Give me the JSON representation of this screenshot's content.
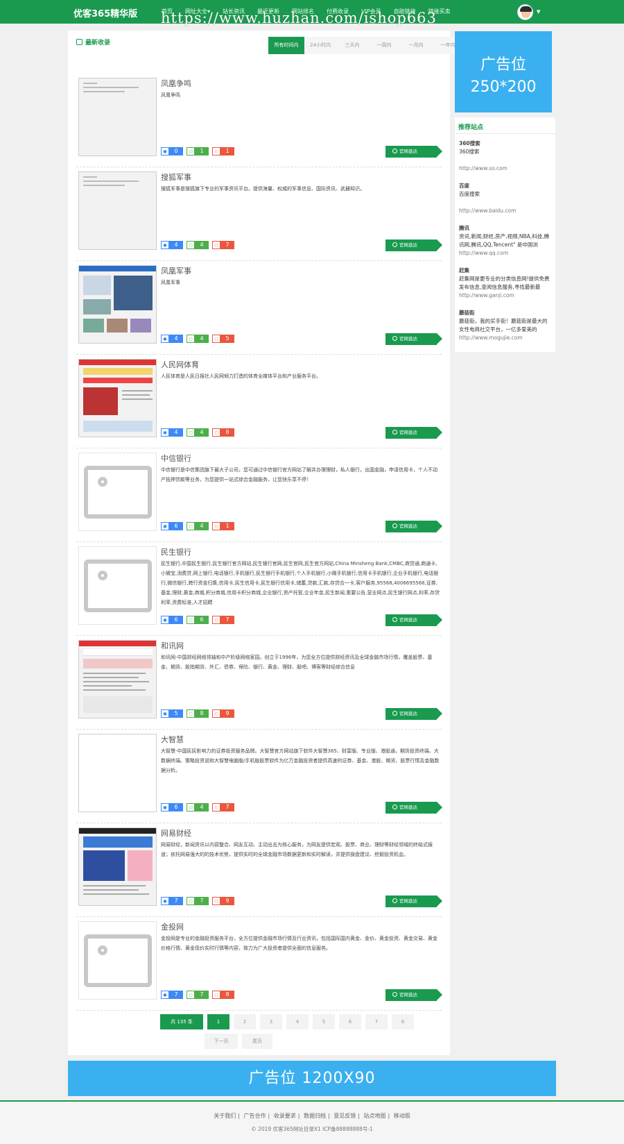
{
  "nav": {
    "logo": "优客365精华版",
    "menu": [
      "首页",
      "网址大全▾",
      "站长资讯",
      "最近更新",
      "网站排名",
      "付费收录",
      "VIP会员",
      "自助链接",
      "链接买卖"
    ],
    "watermark": "https://www.huzhan.com/ishop663"
  },
  "main": {
    "heading": "最新收录",
    "tabs": [
      "所有时间内",
      "24小时内",
      "三天内",
      "一周内",
      "一月内",
      "一年内"
    ]
  },
  "visit_label": "官网直达",
  "items": [
    {
      "title": "凤凰争鸣",
      "desc": "凤凰争鸣",
      "stats": [
        "0",
        "1",
        "1"
      ]
    },
    {
      "title": "搜狐军事",
      "desc": "搜狐军事是搜狐旗下专业的军事资讯平台。提供海量、权威的军事信息、国际资讯、武器知识。",
      "stats": [
        "4",
        "4",
        "7"
      ]
    },
    {
      "title": "凤凰军事",
      "desc": "凤凰军事",
      "stats": [
        "4",
        "4",
        "5"
      ]
    },
    {
      "title": "人民网体育",
      "desc": "人民体育是人民日报社人民网倾力打造的体育全媒体平台和产业服务平台。",
      "stats": [
        "4",
        "4",
        "8"
      ]
    },
    {
      "title": "中信银行",
      "desc": "中信银行是中信集团旗下最大子公司，您可通过中信银行官方网站了解并办理理财，私人银行，出国金融，申请信用卡，个人不动产抵押贷款等业务，为您提供一站式综合金融服务，让您快乐享不停！",
      "stats": [
        "6",
        "4",
        "1"
      ]
    },
    {
      "title": "民生银行",
      "desc": "民生银行,中国民生银行,民生银行官方网站,民生银行官网,民生官网,民生官方网站,China Minsheng Bank,CMBC,商贷通,商通卡,小微宝,消费贷,网上银行,电话银行,手机银行,民生银行手机银行,个人手机银行,小微手机银行,信用卡手机银行,企业手机银行,电话银行,微信银行,跨行资金归集,信用卡,民生信用卡,民生银行信用卡,储蓄,贷款,汇款,存贷合一卡,客户服务,95568,4006695568,证券,基金,理财,黄金,商城,积分商城,信用卡积分商城,企业银行,资产托管,企业年金,民生新闻,重要公告,营业网点,民生银行网点,利率,存贷利率,资费标准,人才招聘",
      "stats": [
        "6",
        "6",
        "7"
      ]
    },
    {
      "title": "和讯网",
      "desc": "和讯网-中国财经网络领袖和中产阶级网络家园。创立于1996年，为您全方位提供财经资讯及全球金融市场行情，覆盖股票、基金、期货、股指期货、外汇、债券、保险、银行、黄金、理财、股吧、博客等财经综合信息",
      "stats": [
        "5",
        "8",
        "9"
      ]
    },
    {
      "title": "大智慧",
      "desc": "大智慧-中国民民影响力的证券投资服务品牌。大智慧官方网站旗下软件大智慧365、财富版、专业版、港股通，期货投资终端、大数据终端、策略投资说和大智慧电脑版/手机版股票软件为亿万金融投资者提供高速的证券、基金、港股、期货、股票行情及金融数据分析。",
      "stats": [
        "6",
        "4",
        "7"
      ]
    },
    {
      "title": "网易财经",
      "desc": "网易财经，新闻资讯以内容整合、网友互动、主动出击为核心服务，为网友提供宏观、股票、商业、理财等财经领域的终结式报道；依托网易强大的的技术优势，提供实时的全球金融市场数据更新和实时解读，并提供操盘建议、挖掘投资机会。",
      "stats": [
        "7",
        "7",
        "9"
      ]
    },
    {
      "title": "金投网",
      "desc": "金投网是专业的金融投资服务平台，全方位提供金融市场行情及行业资讯，包括国际国内黄金、金价、黄金投资、黄金交易、黄金价格行情、黄金现价实时行情等内容，致力为广大投资者提供全面的信息服务。",
      "stats": [
        "7",
        "7",
        "8"
      ]
    }
  ],
  "pager": {
    "total": "共 135 条",
    "pages": [
      "1",
      "2",
      "3",
      "4",
      "5",
      "6",
      "7",
      "8"
    ],
    "next": "下一页",
    "last": "尾页"
  },
  "ad_side": {
    "line1": "广告位",
    "line2": "250*200"
  },
  "sidebar": {
    "title": "推荐站点",
    "sites": [
      {
        "name": "360搜索",
        "desc": "360搜索",
        "url": "http://www.so.com"
      },
      {
        "name": "百度",
        "desc": "百度搜索",
        "url": "http://www.baidu.com"
      },
      {
        "name": "腾讯",
        "desc": "资讯,新闻,财经,房产,视频,NBA,科技,腾讯网,腾讯,QQ,Tencent\" 是中国浏",
        "url": "http://www.qq.com"
      },
      {
        "name": "赶集",
        "desc": "赶集网是更专业的分类信息网!提供免费发布信息,查阅信息服务,寻找最新最",
        "url": "http://www.ganji.com"
      },
      {
        "name": "蘑菇街",
        "desc": "蘑菇街，我的买手街！蘑菇街是最大的女性电商社交平台，一亿多爱美的",
        "url": "http://www.mogujie.com"
      }
    ]
  },
  "ad_bottom": "广告位  1200X90",
  "footer": {
    "links": [
      "关于我们",
      "广告合作",
      "收录要求",
      "数据归档",
      "意见反馈",
      "站点地图",
      "移动版"
    ],
    "copyright": "© 2019 优客365网址目录X1 ICP备88888888号-1"
  }
}
